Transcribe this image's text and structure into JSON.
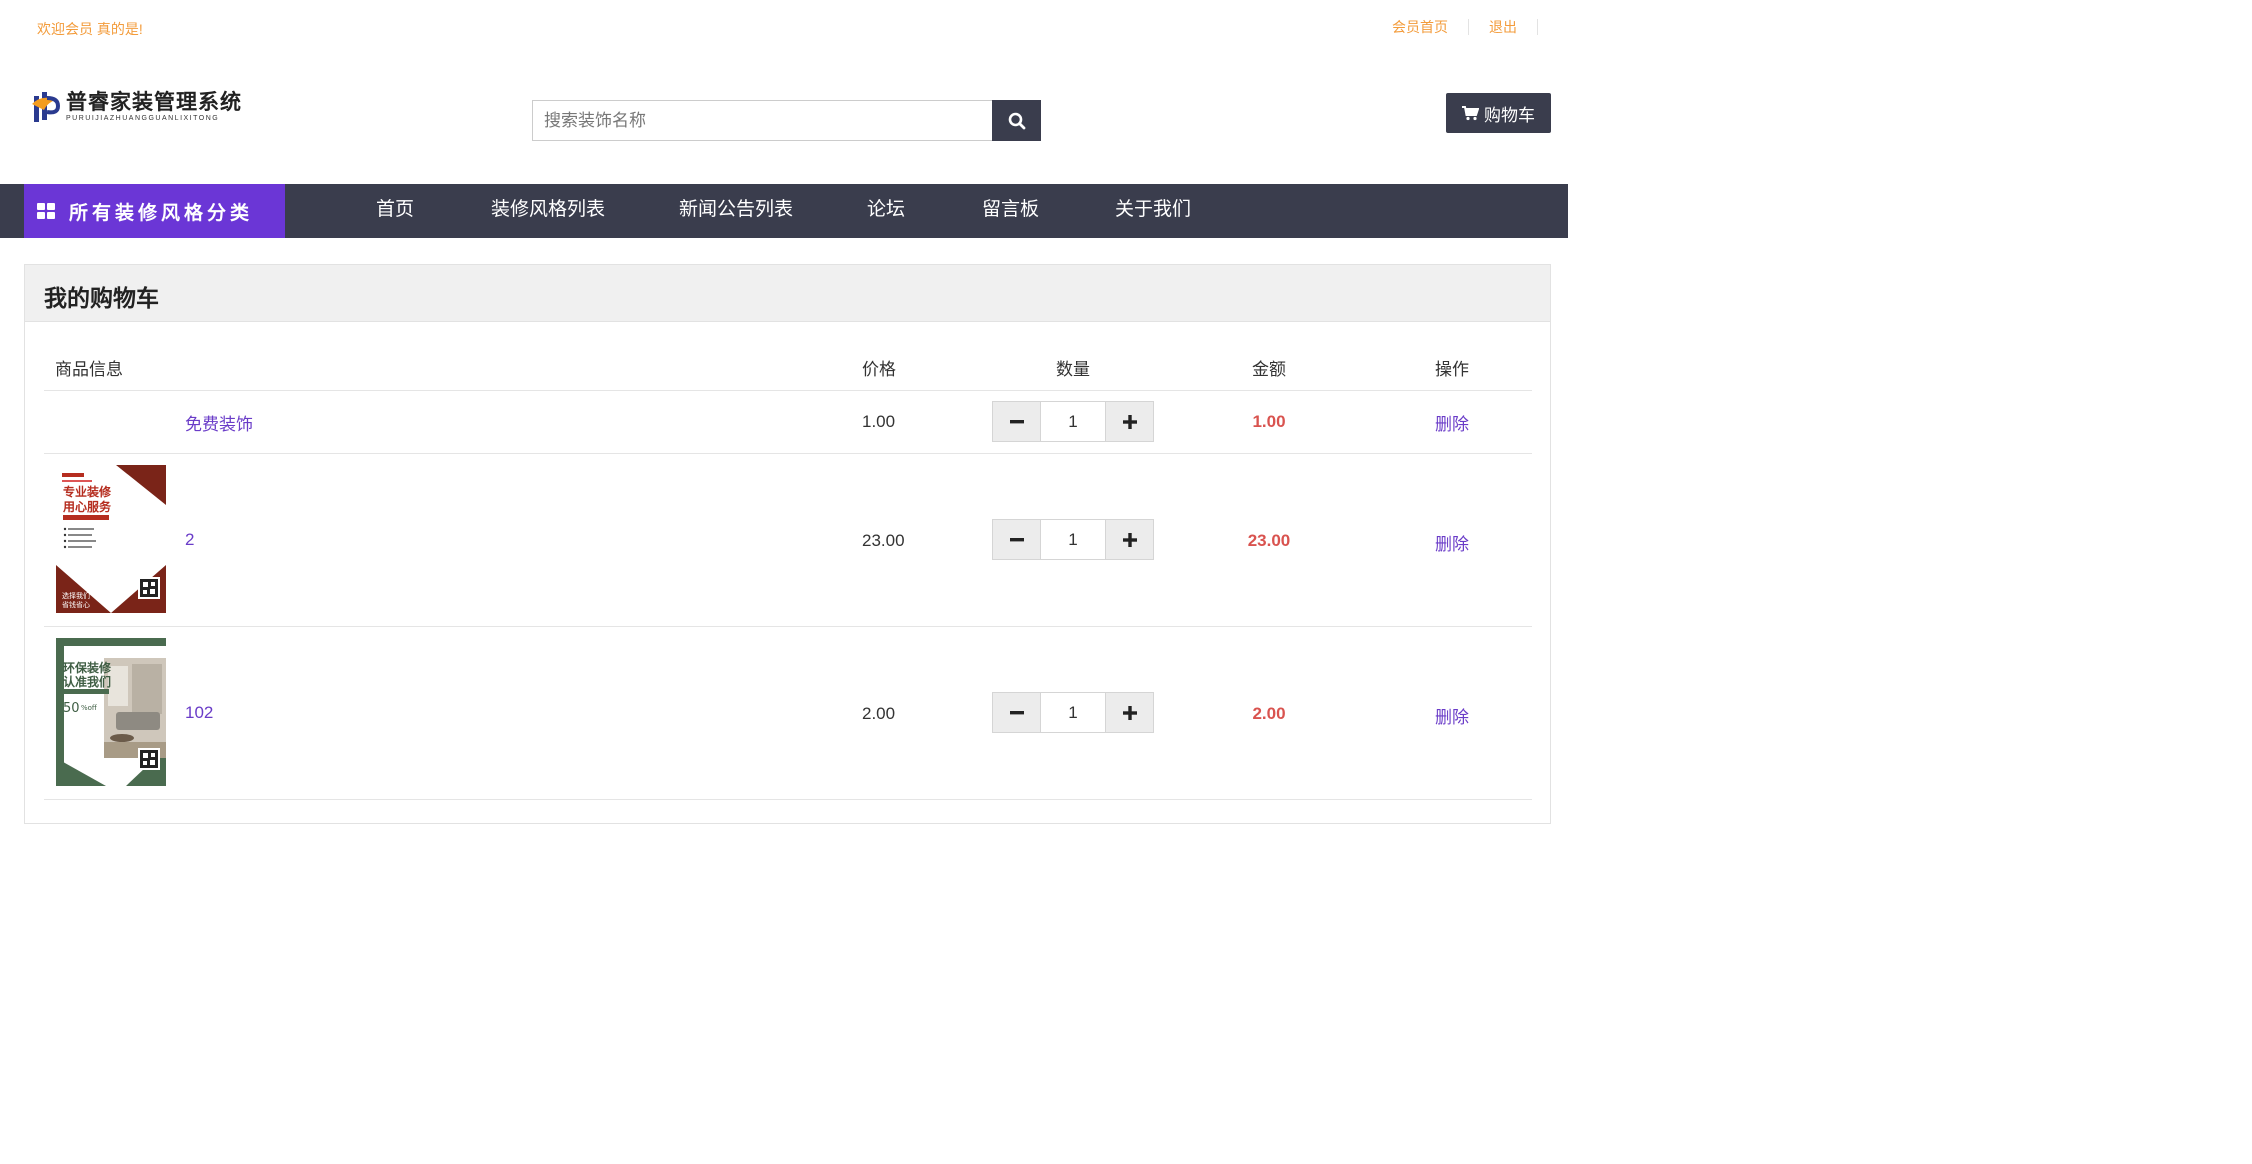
{
  "topbar": {
    "welcome": "欢迎会员 真的是!",
    "member_home": "会员首页",
    "logout": "退出"
  },
  "logo": {
    "title": "普睿家装管理系统",
    "subtitle": "PURUIJIAZHUANGGUANLIXITONG"
  },
  "search": {
    "placeholder": "搜索装饰名称",
    "value": ""
  },
  "cart_button": {
    "label": "购物车"
  },
  "nav": {
    "category_button": "所有装修风格分类",
    "items": [
      {
        "label": "首页"
      },
      {
        "label": "装修风格列表"
      },
      {
        "label": "新闻公告列表"
      },
      {
        "label": "论坛"
      },
      {
        "label": "留言板"
      },
      {
        "label": "关于我们"
      }
    ]
  },
  "cart": {
    "title": "我的购物车",
    "headers": {
      "product": "商品信息",
      "price": "价格",
      "quantity": "数量",
      "amount": "金额",
      "action": "操作"
    },
    "rows": [
      {
        "name": "免费装饰",
        "price": "1.00",
        "quantity": "1",
        "amount": "1.00",
        "action": "删除"
      },
      {
        "name": "2",
        "price": "23.00",
        "quantity": "1",
        "amount": "23.00",
        "action": "删除",
        "thumb": {
          "headline_1": "专业装修",
          "headline_2": "用心服务",
          "footer_1": "选择我们",
          "footer_2": "省钱省心"
        }
      },
      {
        "name": "102",
        "price": "2.00",
        "quantity": "1",
        "amount": "2.00",
        "action": "删除",
        "thumb": {
          "headline_1": "环保装修",
          "headline_2": "认准我们",
          "discount": "50",
          "discount_unit": "%off"
        }
      }
    ]
  },
  "colors": {
    "accent_purple": "#6b36d6",
    "nav_dark": "#3a3d4d",
    "orange": "#f39c3c",
    "amount_red": "#d9534f",
    "link_purple": "#6a3cc8"
  }
}
